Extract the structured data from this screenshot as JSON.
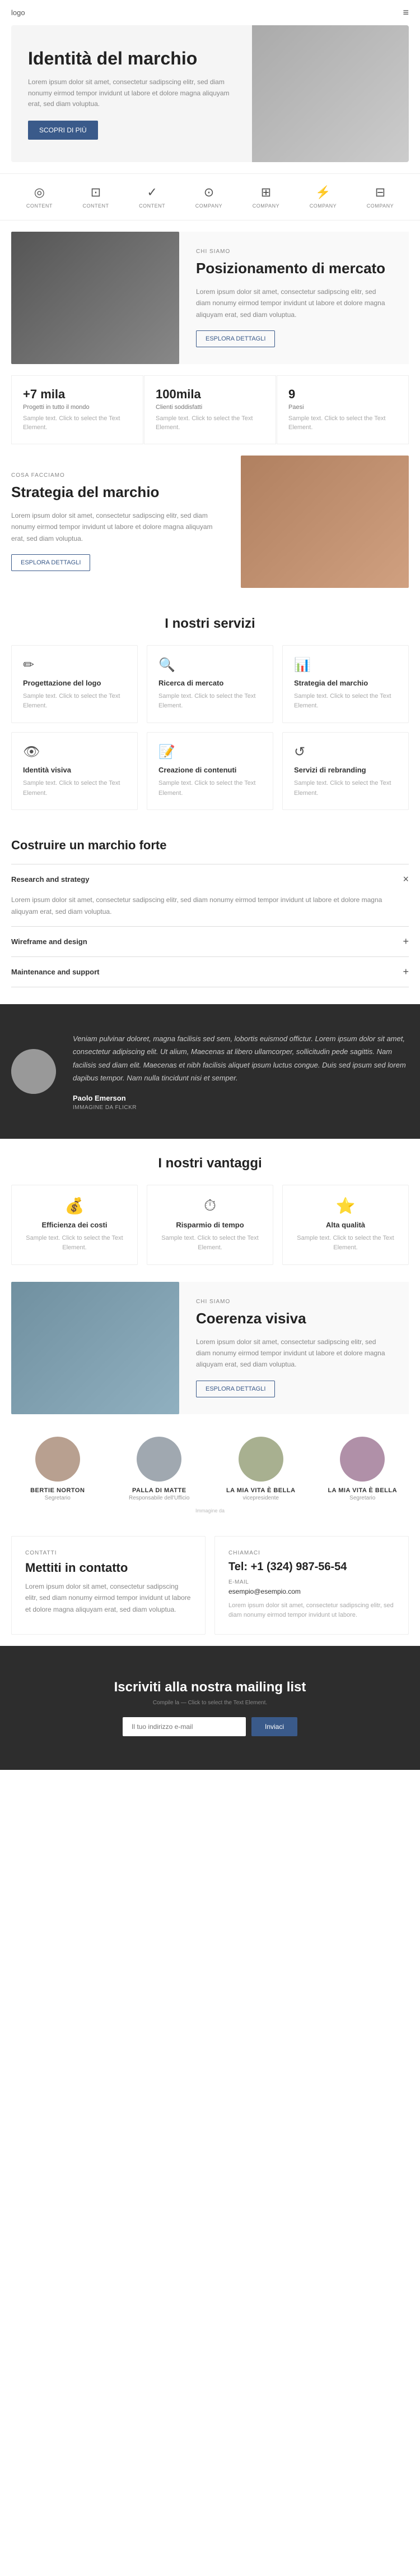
{
  "nav": {
    "logo": "logo",
    "menu_icon": "≡"
  },
  "hero": {
    "title": "Identità del marchio",
    "description": "Lorem ipsum dolor sit amet, consectetur sadipscing elitr, sed diam nonumy eirmod tempor invidunt ut labore et dolore magna aliquyam erat, sed diam voluptua.",
    "button": "SCOPRI DI PIÙ"
  },
  "icons": [
    {
      "label": "CONTENT",
      "symbol": "◎"
    },
    {
      "label": "CONTENT",
      "symbol": "⊡"
    },
    {
      "label": "CONTENT",
      "symbol": "✓"
    },
    {
      "label": "COMPANY",
      "symbol": "⊙"
    },
    {
      "label": "COMPANY",
      "symbol": "⊞"
    },
    {
      "label": "COMPANY",
      "symbol": "⚡"
    },
    {
      "label": "COMPANY",
      "symbol": "⊟"
    }
  ],
  "who_we_are": {
    "tag": "CHI SIAMO",
    "title": "Posizionamento di mercato",
    "description": "Lorem ipsum dolor sit amet, consectetur sadipscing elitr, sed diam nonumy eirmod tempor invidunt ut labore et dolore magna aliquyam erat, sed diam voluptua.",
    "button": "ESPLORA DETTAGLI"
  },
  "stats": [
    {
      "number": "+7 mila",
      "label": "Progetti in tutto il mondo",
      "description": "Sample text. Click to select the Text Element."
    },
    {
      "number": "100mila",
      "label": "Clienti soddisfatti",
      "description": "Sample text. Click to select the Text Element."
    },
    {
      "number": "9",
      "label": "Paesi",
      "description": "Sample text. Click to select the Text Element."
    }
  ],
  "strategy": {
    "tag": "COSA FACCIAMO",
    "title": "Strategia del marchio",
    "description": "Lorem ipsum dolor sit amet, consectetur sadipscing elitr, sed diam nonumy eirmod tempor invidunt ut labore et dolore magna aliquyam erat, sed diam voluptua.",
    "button": "ESPLORA DETTAGLI"
  },
  "services": {
    "title": "I nostri servizi",
    "items": [
      {
        "name": "Progettazione del logo",
        "icon": "✏",
        "description": "Sample text. Click to select the Text Element."
      },
      {
        "name": "Ricerca di mercato",
        "icon": "🔍",
        "description": "Sample text. Click to select the Text Element."
      },
      {
        "name": "Strategia del marchio",
        "icon": "📊",
        "description": "Sample text. Click to select the Text Element."
      },
      {
        "name": "Identità visiva",
        "icon": "👁",
        "description": "Sample text. Click to select the Text Element."
      },
      {
        "name": "Creazione di contenuti",
        "icon": "📝",
        "description": "Sample text. Click to select the Text Element."
      },
      {
        "name": "Servizi di rebranding",
        "icon": "↺",
        "description": "Sample text. Click to select the Text Element."
      }
    ]
  },
  "build": {
    "title": "Costruire un marchio forte",
    "accordion": [
      {
        "label": "Research and strategy",
        "body": "Lorem ipsum dolor sit amet, consectetur sadipscing elitr, sed diam nonumy eirmod tempor invidunt ut labore et dolore magna aliquyam erat, sed diam voluptua.",
        "open": true
      },
      {
        "label": "Wireframe and design",
        "body": "",
        "open": false
      },
      {
        "label": "Maintenance and support",
        "body": "",
        "open": false
      }
    ]
  },
  "testimonial": {
    "text": "Veniam pulvinar doloret, magna facilisis sed sem, lobortis euismod offictur. Lorem ipsum dolor sit amet, consectetur adipiscing elit. Ut alium, Maecenas at libero ullamcorper, sollicitudin pede sagittis. Nam facilisis sed diam elit. Maecenas et nibh facilisis aliquet ipsum luctus congue. Duis sed ipsum sed lorem dapibus tempor. Nam nulla tincidunt nisi et semper.",
    "name": "Paolo Emerson",
    "role": "Immagine da Flickr",
    "avatar_bg": "#888"
  },
  "advantages": {
    "title": "I nostri vantaggi",
    "items": [
      {
        "name": "Efficienza dei costi",
        "icon": "💰",
        "description": "Sample text. Click to select the Text Element."
      },
      {
        "name": "Risparmio di tempo",
        "icon": "⏱",
        "description": "Sample text. Click to select the Text Element."
      },
      {
        "name": "Alta qualità",
        "icon": "⭐",
        "description": "Sample text. Click to select the Text Element."
      }
    ]
  },
  "visual_coherence": {
    "tag": "CHI SIAMO",
    "title": "Coerenza visiva",
    "description": "Lorem ipsum dolor sit amet, consectetur sadipscing elitr, sed diam nonumy eirmod tempor invidunt ut labore et dolore magna aliquyam erat, sed diam voluptua.",
    "button": "ESPLORA DETTAGLI"
  },
  "team": {
    "image_note": "Immagine da",
    "members": [
      {
        "name": "BERTIE NORTON",
        "role": "Segretario"
      },
      {
        "name": "PALLA DI MATTE",
        "role": "Responsabile dell'Ufficio"
      },
      {
        "name": "LA MIA VITA È BELLA",
        "role": "vicepresidente"
      },
      {
        "name": "LA MIA VITA È BELLA",
        "role": "Segretario"
      }
    ]
  },
  "contact": {
    "tag": "CONTATTI",
    "title": "Mettiti in contatto",
    "description": "Lorem ipsum dolor sit amet, consectetur sadipscing elitr, sed diam nonumy eirmod tempor invidunt ut labore et dolore magna aliquyam erat, sed diam voluptua.",
    "call_tag": "CHIAMACI",
    "phone": "Tel: +1 (324) 987-56-54",
    "email_label": "E-MAIL",
    "email": "esempio@esempio.com",
    "note": "Lorem ipsum dolor sit amet, consectetur sadipscing elitr, sed diam nonumy eirmod tempor invidunt ut labore."
  },
  "newsletter": {
    "title": "Iscriviti alla nostra mailing list",
    "note": "Compile la — Click to select the Text Element.",
    "input_placeholder": "Il tuo indirizzo e-mail",
    "button": "Inviaci"
  }
}
